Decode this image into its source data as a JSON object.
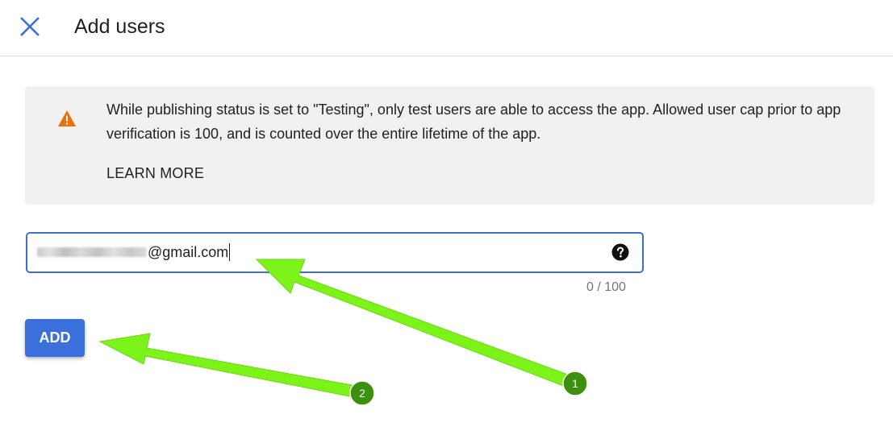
{
  "header": {
    "title": "Add users",
    "close_icon": "close-icon"
  },
  "banner": {
    "icon": "warning-icon",
    "message": "While publishing status is set to \"Testing\", only test users are able to access the app. Allowed user cap prior to app verification is 100, and is counted over the entire lifetime of the app.",
    "learn_more_label": "LEARN MORE"
  },
  "email_input": {
    "value_suffix": "@gmail.com",
    "help_icon": "help-circle-icon",
    "counter": "0 / 100"
  },
  "add_button": {
    "label": "ADD"
  },
  "annotations": [
    {
      "label": "1"
    },
    {
      "label": "2"
    }
  ],
  "colors": {
    "accent": "#3b6fdc",
    "input_border": "#3c6fcf",
    "warning": "#e8710a",
    "annotation_arrow": "#7cf41a",
    "annotation_badge": "#3d8f0e"
  }
}
